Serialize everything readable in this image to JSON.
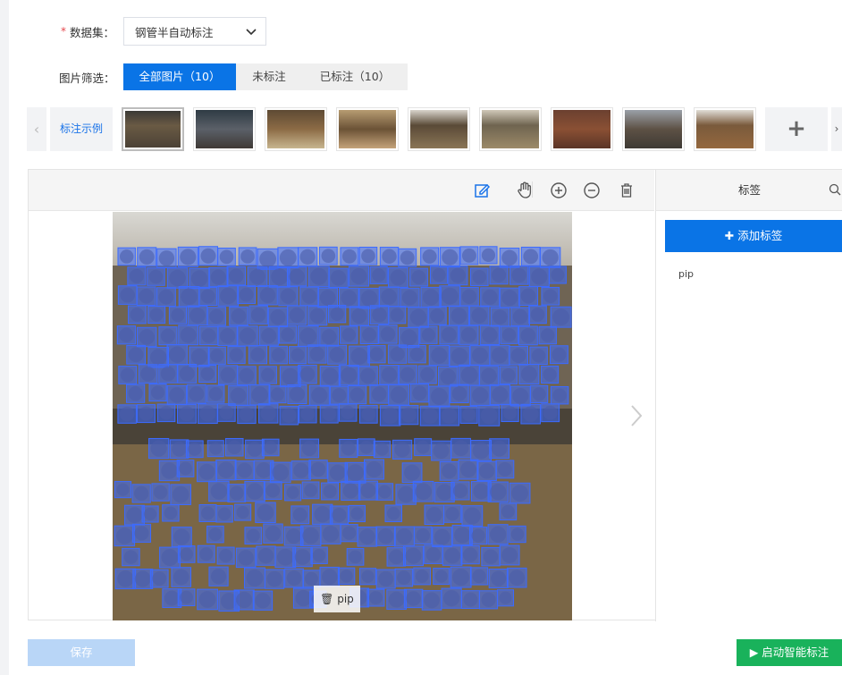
{
  "form": {
    "dataset_required": "*",
    "dataset_label": "数据集：",
    "dataset_value": "钢管半自动标注",
    "filter_label": "图片筛选：",
    "filters": [
      "全部图片（10）",
      "未标注",
      "已标注（10）"
    ]
  },
  "strip": {
    "prev": "‹",
    "example_label": "标注示例",
    "add": "+",
    "next": "›"
  },
  "panel": {
    "title": "标签",
    "add_label_button": "✚ 添加标签",
    "labels": [
      "pip"
    ]
  },
  "canvas": {
    "selected_label": "pip"
  },
  "footer": {
    "save_button": "保存",
    "start_button": "▶ 启动智能标注"
  },
  "colors": {
    "accent": "#0a74e6",
    "success": "#19b25b",
    "annotation": "#3c6bff"
  }
}
